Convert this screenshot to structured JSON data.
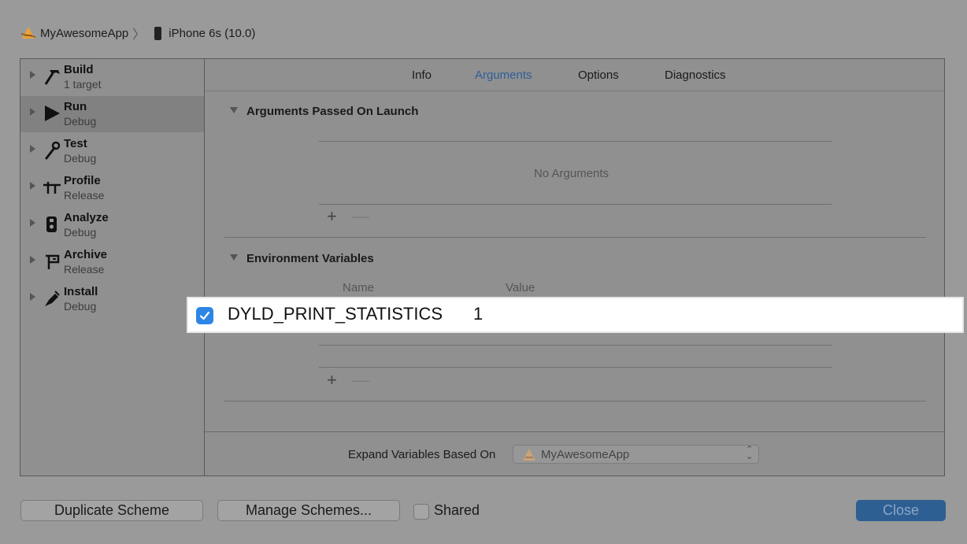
{
  "breadcrumb": {
    "scheme": "MyAwesomeApp",
    "separator": "〉",
    "device": "iPhone 6s (10.0)"
  },
  "sidebar": {
    "items": [
      {
        "title": "Build",
        "subtitle": "1 target",
        "icon": "hammer-icon"
      },
      {
        "title": "Run",
        "subtitle": "Debug",
        "icon": "play-icon",
        "selected": true
      },
      {
        "title": "Test",
        "subtitle": "Debug",
        "icon": "wrench-icon"
      },
      {
        "title": "Profile",
        "subtitle": "Release",
        "icon": "caliper-icon"
      },
      {
        "title": "Analyze",
        "subtitle": "Debug",
        "icon": "analyze-icon"
      },
      {
        "title": "Archive",
        "subtitle": "Release",
        "icon": "archive-icon"
      },
      {
        "title": "Install",
        "subtitle": "Debug",
        "icon": "install-icon"
      }
    ]
  },
  "tabs": [
    {
      "label": "Info",
      "active": false
    },
    {
      "label": "Arguments",
      "active": true
    },
    {
      "label": "Options",
      "active": false
    },
    {
      "label": "Diagnostics",
      "active": false
    }
  ],
  "arguments": {
    "header": "Arguments Passed On Launch",
    "empty_text": "No Arguments",
    "add_label": "+",
    "remove_label": "—"
  },
  "environment": {
    "header": "Environment Variables",
    "col_name": "Name",
    "col_value": "Value",
    "add_label": "+",
    "remove_label": "—",
    "rows": [
      {
        "enabled": true,
        "name": "DYLD_PRINT_STATISTICS",
        "value": "1"
      }
    ]
  },
  "expand": {
    "label": "Expand Variables Based On",
    "value": "MyAwesomeApp",
    "arrows": "⌃⌄"
  },
  "footer": {
    "duplicate_label": "Duplicate Scheme",
    "manage_label": "Manage Schemes...",
    "shared_label": "Shared",
    "close_label": "Close"
  },
  "colors": {
    "accent": "#2d86e6",
    "tab_active": "#2f5f98",
    "close_button": "#2e5f92"
  }
}
